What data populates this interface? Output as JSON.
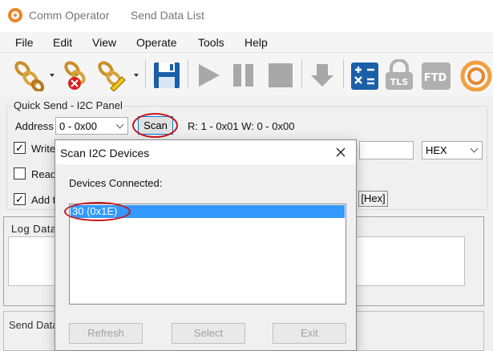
{
  "window": {
    "app_name": "Comm Operator",
    "document_title": "Send Data List"
  },
  "menu": [
    "File",
    "Edit",
    "View",
    "Operate",
    "Tools",
    "Help"
  ],
  "toolbar": {
    "icons": [
      "connect-icon",
      "disconnect-icon",
      "edit-connection-icon",
      "save-icon",
      "play-icon",
      "pause-icon",
      "stop-icon",
      "download-icon",
      "calculator-icon",
      "tls-icon",
      "ftdi-icon",
      "app-logo-icon"
    ],
    "tls_label": "TLS",
    "ftdi_label": "FTD"
  },
  "quick_send": {
    "panel_title": "Quick Send - I2C Panel",
    "address_label": "Address",
    "address_value": "0 - 0x00",
    "scan_label": "Scan",
    "rw_info": "R: 1 - 0x01  W: 0 - 0x00",
    "write_label": "Write",
    "read_label": "Read",
    "add_label": "Add t",
    "write_checked": true,
    "read_checked": false,
    "add_checked": true,
    "format_value": "HEX",
    "hex_tag": "[Hex]"
  },
  "log": {
    "title": "Log Data"
  },
  "send": {
    "title": "Send Data"
  },
  "dialog": {
    "title": "Scan I2C Devices",
    "devices_label": "Devices Connected:",
    "devices": [
      "30  (0x1E)"
    ],
    "buttons": {
      "refresh": "Refresh",
      "select": "Select",
      "exit": "Exit"
    }
  },
  "colors": {
    "highlight": "#3399ff",
    "annotation_red": "#c8151b",
    "accent_blue": "#1a5fa8"
  }
}
